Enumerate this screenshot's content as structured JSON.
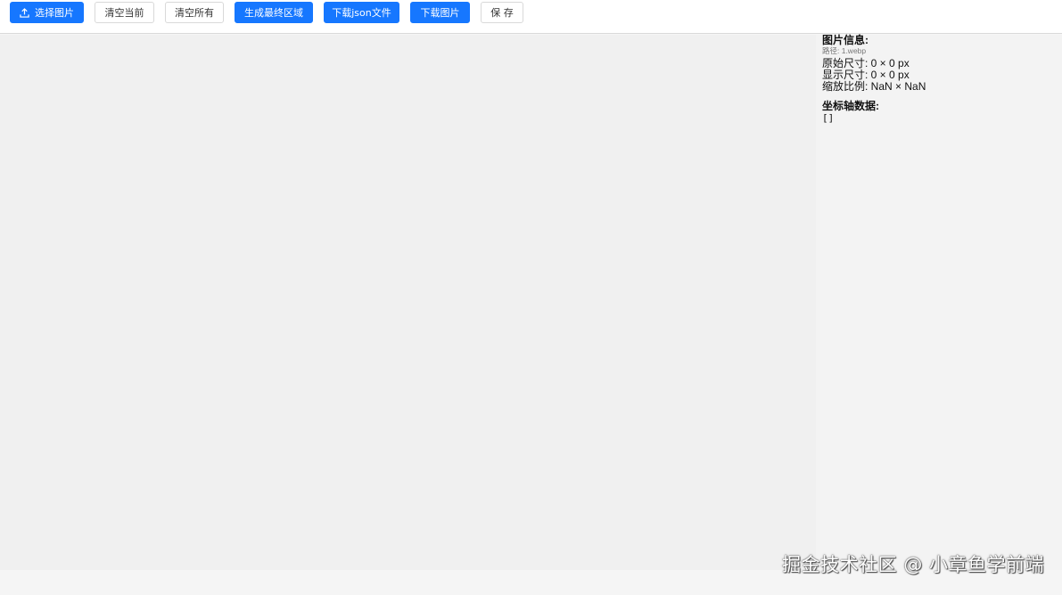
{
  "toolbar": {
    "select_image": "选择图片",
    "clear_current": "清空当前",
    "clear_all": "清空所有",
    "generate_final_region": "生成最终区域",
    "download_json": "下载json文件",
    "download_image": "下载图片",
    "save": "保 存",
    "upload_icon": "upload-icon"
  },
  "info": {
    "title": "图片信息:",
    "path": "路径: 1.webp",
    "original_size": "原始尺寸: 0 × 0 px",
    "display_size": "显示尺寸: 0 × 0 px",
    "scale": "缩放比例: NaN × NaN",
    "axis_title": "坐标轴数据:",
    "axis_value": "[]"
  },
  "watermark": "掘金技术社区 @ 小章鱼学前端",
  "colors": {
    "primary": "#1677ff",
    "toolbar_bg": "#ffffff",
    "canvas_bg": "#f0f0f0",
    "panel_bg": "#f3f3f3"
  }
}
